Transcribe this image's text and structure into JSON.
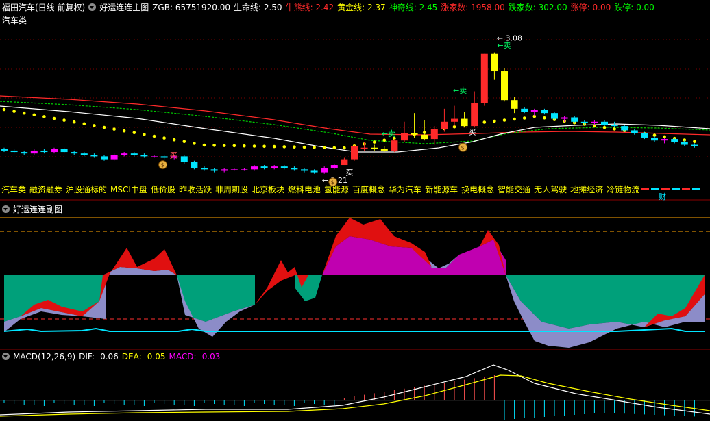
{
  "main_header": {
    "title": "福田汽车(日线 前复权)",
    "indicator": "好运连连主图",
    "zgb_label": "ZGB: 65751920.00",
    "life_line": "生命线: 2.50",
    "bull_line": "牛熊线: 2.42",
    "gold_line": "黄金线: 2.37",
    "magic_line": "神奇线: 2.45",
    "up_count": "涨家数: 1958.00",
    "down_count": "跌家数: 302.00",
    "limit_up": "涨停: 0.00",
    "limit_down": "跌停: 0.00",
    "sector": "汽车类"
  },
  "annotations": {
    "high_price": "3.08",
    "low_price": "2.21",
    "buy": "买",
    "sell": "卖",
    "finance_tag": "财"
  },
  "concepts": [
    "汽车类",
    "融资融券",
    "沪股通标的",
    "MSCI中盘",
    "低价股",
    "昨收活跃",
    "非周期股",
    "北京板块",
    "燃料电池",
    "氢能源",
    "百度概念",
    "华为汽车",
    "新能源车",
    "换电概念",
    "智能交通",
    "无人驾驶",
    "地摊经济",
    "冷链物流"
  ],
  "sub_header": {
    "title": "好运连连副图"
  },
  "macd_header": {
    "title": "MACD(12,26,9)",
    "dif": "DIF: -0.06",
    "dea": "DEA: -0.05",
    "macd": "MACD: -0.03"
  },
  "colors": {
    "up": "#ff2a2a",
    "down": "#00e5ff",
    "magenta": "#ff00ff",
    "yellow": "#ffff00",
    "teal": "#00a07a",
    "lavender": "#8c8cc8"
  },
  "candles": [
    [
      2.3,
      2.31,
      2.28,
      2.29
    ],
    [
      2.29,
      2.3,
      2.27,
      2.28
    ],
    [
      2.28,
      2.29,
      2.26,
      2.27
    ],
    [
      2.27,
      2.3,
      2.26,
      2.29
    ],
    [
      2.29,
      2.3,
      2.27,
      2.28
    ],
    [
      2.28,
      2.31,
      2.27,
      2.3
    ],
    [
      2.3,
      2.31,
      2.27,
      2.28
    ],
    [
      2.28,
      2.29,
      2.26,
      2.27
    ],
    [
      2.27,
      2.28,
      2.25,
      2.26
    ],
    [
      2.26,
      2.27,
      2.24,
      2.25
    ],
    [
      2.25,
      2.26,
      2.22,
      2.23
    ],
    [
      2.23,
      2.27,
      2.22,
      2.26
    ],
    [
      2.26,
      2.28,
      2.25,
      2.27
    ],
    [
      2.27,
      2.28,
      2.25,
      2.26
    ],
    [
      2.26,
      2.27,
      2.24,
      2.25
    ],
    [
      2.25,
      2.26,
      2.24,
      2.25
    ],
    [
      2.25,
      2.26,
      2.23,
      2.24
    ],
    [
      2.24,
      2.26,
      2.23,
      2.25
    ],
    [
      2.25,
      2.26,
      2.2,
      2.21
    ],
    [
      2.21,
      2.22,
      2.16,
      2.17
    ],
    [
      2.17,
      2.18,
      2.15,
      2.16
    ],
    [
      2.16,
      2.17,
      2.14,
      2.15
    ],
    [
      2.15,
      2.17,
      2.14,
      2.16
    ],
    [
      2.16,
      2.17,
      2.15,
      2.16
    ],
    [
      2.16,
      2.17,
      2.15,
      2.16
    ],
    [
      2.16,
      2.19,
      2.15,
      2.18
    ],
    [
      2.18,
      2.19,
      2.16,
      2.17
    ],
    [
      2.17,
      2.19,
      2.16,
      2.18
    ],
    [
      2.18,
      2.19,
      2.16,
      2.17
    ],
    [
      2.17,
      2.18,
      2.15,
      2.16
    ],
    [
      2.16,
      2.17,
      2.14,
      2.15
    ],
    [
      2.15,
      2.16,
      2.13,
      2.14
    ],
    [
      2.14,
      2.18,
      2.13,
      2.17
    ],
    [
      2.17,
      2.2,
      2.16,
      2.19
    ],
    [
      2.19,
      2.24,
      2.19,
      2.23
    ],
    [
      2.23,
      2.33,
      2.22,
      2.32
    ],
    [
      2.3,
      2.35,
      2.29,
      2.31
    ],
    [
      2.31,
      2.33,
      2.29,
      2.3
    ],
    [
      2.3,
      2.32,
      2.28,
      2.29
    ],
    [
      2.29,
      2.37,
      2.28,
      2.36
    ],
    [
      2.36,
      2.49,
      2.35,
      2.41
    ],
    [
      2.41,
      2.55,
      2.38,
      2.4
    ],
    [
      2.4,
      2.5,
      2.36,
      2.37
    ],
    [
      2.37,
      2.46,
      2.33,
      2.44
    ],
    [
      2.44,
      2.58,
      2.42,
      2.49
    ],
    [
      2.49,
      2.6,
      2.46,
      2.51
    ],
    [
      2.51,
      2.56,
      2.45,
      2.46
    ],
    [
      2.46,
      2.7,
      2.45,
      2.62
    ],
    [
      2.62,
      2.96,
      2.6,
      2.96
    ],
    [
      2.96,
      2.97,
      2.78,
      2.84
    ],
    [
      2.84,
      2.86,
      2.63,
      2.64
    ],
    [
      2.64,
      2.66,
      2.55,
      2.58
    ],
    [
      2.58,
      2.59,
      2.55,
      2.56
    ],
    [
      2.56,
      2.58,
      2.53,
      2.57
    ],
    [
      2.57,
      2.58,
      2.54,
      2.55
    ],
    [
      2.55,
      2.56,
      2.5,
      2.51
    ],
    [
      2.51,
      2.53,
      2.49,
      2.52
    ],
    [
      2.52,
      2.53,
      2.48,
      2.49
    ],
    [
      2.49,
      2.5,
      2.47,
      2.48
    ],
    [
      2.48,
      2.5,
      2.47,
      2.49
    ],
    [
      2.49,
      2.5,
      2.46,
      2.47
    ],
    [
      2.47,
      2.49,
      2.45,
      2.46
    ],
    [
      2.46,
      2.47,
      2.42,
      2.43
    ],
    [
      2.43,
      2.44,
      2.4,
      2.41
    ],
    [
      2.41,
      2.42,
      2.37,
      2.38
    ],
    [
      2.38,
      2.39,
      2.35,
      2.36
    ],
    [
      2.36,
      2.38,
      2.34,
      2.37
    ],
    [
      2.37,
      2.38,
      2.34,
      2.35
    ],
    [
      2.35,
      2.36,
      2.32,
      2.33
    ],
    [
      2.33,
      2.34,
      2.31,
      2.32
    ]
  ]
}
